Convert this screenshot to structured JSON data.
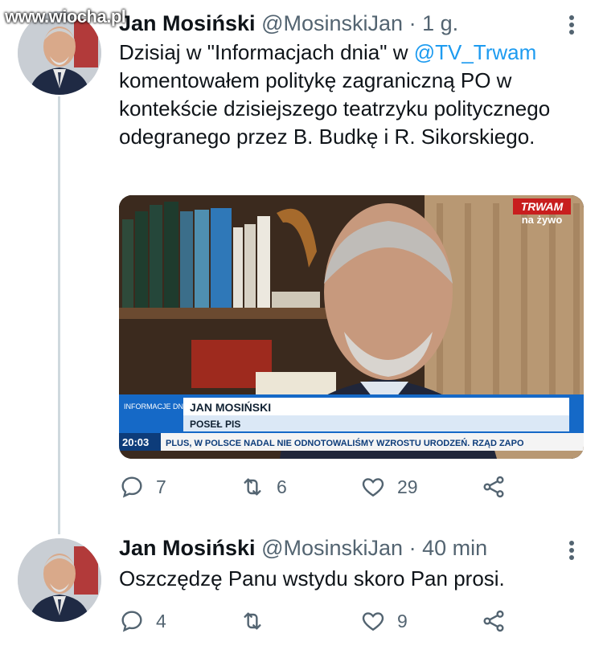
{
  "watermark": "www.wiocha.pl",
  "tweet1": {
    "name": "Jan Mosiński",
    "handle": "@MosinskiJan",
    "sep": "·",
    "time": "1 g.",
    "text_before": "Dzisiaj w \"Informacjach dnia\" w ",
    "mention": "@TV_Trwam",
    "text_after": " komentowałem politykę zagraniczną PO w kontekście dzisiejszego teatrzyku politycznego odegranego przez B. Budkę i R. Sikorskiego.",
    "media": {
      "logo": "TRWAM",
      "live": "na żywo",
      "program": "INFORMACJE DNIA",
      "caption_name": "JAN MOSIŃSKI",
      "caption_role": "POSEŁ PIS",
      "clock": "20:03",
      "ticker": "PLUS, W POLSCE NADAL NIE ODNOTOWALIŚMY WZROSTU URODZEŃ. RZĄD ZAPO"
    },
    "replies": "7",
    "retweets": "6",
    "likes": "29"
  },
  "tweet2": {
    "name": "Jan Mosiński",
    "handle": "@MosinskiJan",
    "sep": "·",
    "time": "40 min",
    "text": "Oszczędzę Panu wstydu skoro Pan prosi.",
    "replies": "4",
    "retweets": "",
    "likes": "9"
  },
  "icons": [
    "reply-icon",
    "retweet-icon",
    "like-icon",
    "share-icon",
    "more-icon"
  ],
  "colors": {
    "accent": "#1d9bf0",
    "muted": "#536471",
    "thread": "#cfd9de"
  }
}
